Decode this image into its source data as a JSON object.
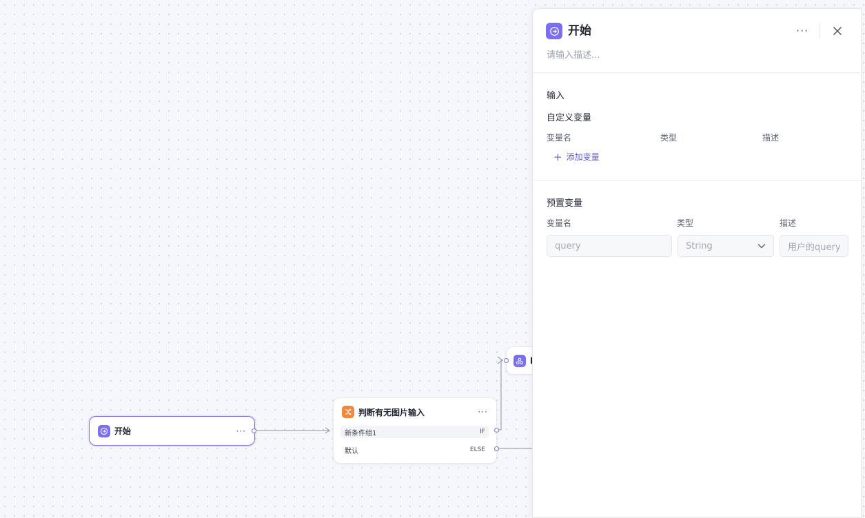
{
  "canvas": {
    "start_node": {
      "title": "开始",
      "more": "···"
    },
    "condition_node": {
      "title": "判断有无图片输入",
      "more": "···",
      "branches": [
        {
          "label": "新条件组1",
          "tag": "IF"
        },
        {
          "label": "默认",
          "tag": "ELSE"
        }
      ]
    },
    "partial_node": {
      "title_fragment": "l"
    }
  },
  "panel": {
    "title": "开始",
    "more": "···",
    "description_placeholder": "请输入描述...",
    "input_section_title": "输入",
    "custom_vars": {
      "title": "自定义变量",
      "columns": [
        "变量名",
        "类型",
        "描述"
      ],
      "add_label": "添加变量",
      "add_symbol": "+"
    },
    "preset_vars": {
      "title": "预置变量",
      "columns": [
        "变量名",
        "类型",
        "描述"
      ],
      "rows": [
        {
          "name": "query",
          "type": "String",
          "description": "用户的query"
        }
      ]
    }
  },
  "colors": {
    "accent": "#7a6ff0",
    "condition_icon": "#f0883e",
    "link": "#5b5fc7"
  },
  "icons": [
    "start-node-icon",
    "condition-node-icon",
    "llm-node-icon",
    "close-icon",
    "chevron-down-icon",
    "plus-icon"
  ]
}
